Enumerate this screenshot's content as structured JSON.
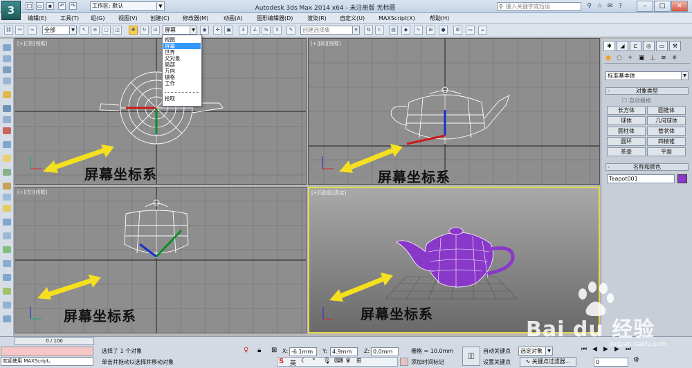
{
  "titlebar": {
    "logo_text": "3",
    "workspace_label": "工作区: 默认",
    "app_title": "Autodesk 3ds Max  2014 x64  - 未注册版   无标题",
    "search_placeholder": "键入关键字或短语"
  },
  "menu": [
    "编辑(E)",
    "工具(T)",
    "组(G)",
    "视图(V)",
    "创建(C)",
    "修改器(M)",
    "动画(A)",
    "图形编辑器(D)",
    "渲染(R)",
    "自定义(U)",
    "MAXScript(X)",
    "帮助(H)"
  ],
  "toolbar": {
    "selection_filter": "全部",
    "coord_system": "屏幕",
    "named_selection_placeholder": "创建选择集"
  },
  "coord_dropdown": {
    "items": [
      "视图",
      "屏幕",
      "世界",
      "父对象",
      "局部",
      "万向",
      "栅格",
      "工作",
      "拾取"
    ],
    "selected": "屏幕"
  },
  "viewports": [
    {
      "label": "[+][顶][线框]",
      "overlay": "屏幕坐标系"
    },
    {
      "label": "[+][前][线框]",
      "overlay": "屏幕坐标系"
    },
    {
      "label": "[+][左][线框]",
      "overlay": "屏幕坐标系"
    },
    {
      "label": "[+][透视][真实]",
      "overlay": "屏幕坐标系"
    }
  ],
  "command_panel": {
    "category": "标准基本体",
    "object_type_header": "对象类型",
    "autogrid_label": "自动栅格",
    "object_buttons": [
      "长方体",
      "圆锥体",
      "球体",
      "几何球体",
      "圆柱体",
      "管状体",
      "圆环",
      "四棱锥",
      "茶壶",
      "平面"
    ],
    "name_color_header": "名称和颜色",
    "object_name": "Teapot001",
    "object_color": "#8a38c9"
  },
  "status": {
    "timeline": "0 / 100",
    "maxscript_welcome": "欢迎使用 MAXScript。",
    "selection_status": "选择了 1 个对象",
    "prompt": "单击并拖动以选择并移动对象",
    "x_label": "X:",
    "x_value": "-6.1mm",
    "y_label": "Y:",
    "y_value": "4.9mm",
    "z_label": "Z:",
    "z_value": "0.0mm",
    "grid": "栅格 = 10.0mm",
    "add_time_tag": "添加时间标记",
    "auto_key": "自动关键点",
    "set_key": "设置关键点",
    "selected_objects": "选定对象",
    "key_filters": "关键点过滤器...",
    "frame": "0",
    "ime_label": "英"
  },
  "watermark": {
    "brand": "Bai   du 经验",
    "url": "jingyan.baidu.com"
  },
  "colors": {
    "viewport_bg": "#8e8e8e",
    "perspective_bg": "#6d6d6d",
    "active_border": "#e6d84c",
    "teapot_purple": "#8a38c9",
    "arrow_yellow": "#f5e020"
  }
}
